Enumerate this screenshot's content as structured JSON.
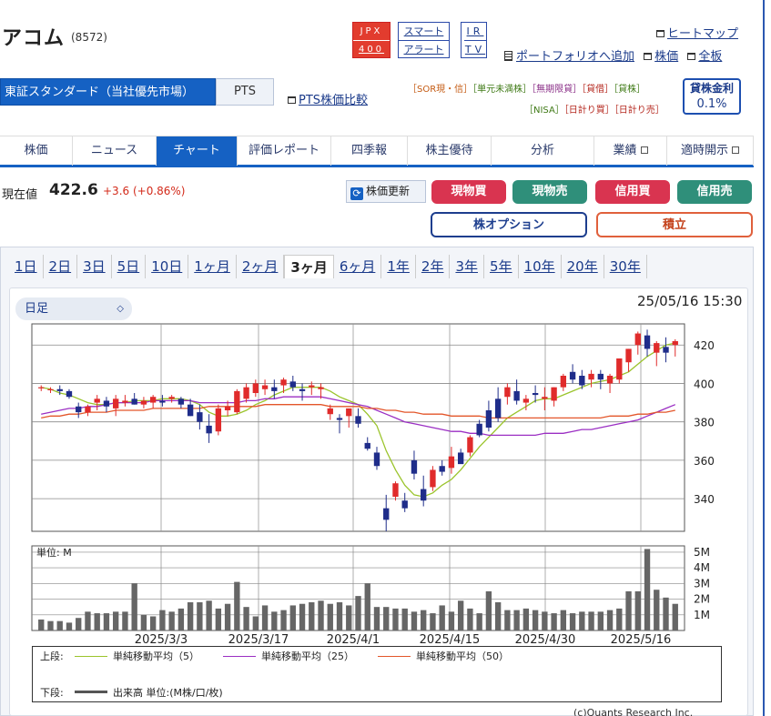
{
  "header": {
    "name": "アコム",
    "code": "(8572)",
    "jpx": [
      "JPX",
      "400"
    ],
    "smart_alert": [
      "スマート",
      "アラート"
    ],
    "ir_tv": [
      "IR",
      "TV"
    ],
    "links": {
      "heatmap": "ヒートマップ",
      "portfolio": "ポートフォリオへ追加",
      "stock": "株価",
      "board": "全板"
    }
  },
  "market": {
    "selected": "東証スタンダード（当社優先市場）",
    "pts": "PTS",
    "pts_compare": "PTS株価比較",
    "tags_row1": [
      {
        "text": "［SOR現・信］",
        "color": "o"
      },
      {
        "text": "［単元未満株］",
        "color": "g"
      },
      {
        "text": "［無期限貸］",
        "color": "p"
      },
      {
        "text": "［貸借］",
        "color": "r"
      },
      {
        "text": "［貸株］",
        "color": "g"
      }
    ],
    "tags_row2": [
      {
        "text": "［NISA］",
        "color": "g"
      },
      {
        "text": "［日計り買］",
        "color": "r"
      },
      {
        "text": "［日計り売］",
        "color": "r"
      }
    ],
    "lend_label": "貸株金利",
    "lend_rate": "0.1%"
  },
  "nav": [
    {
      "label": "株価",
      "width": 80
    },
    {
      "label": "ニュース",
      "width": 92
    },
    {
      "label": "チャート",
      "width": 89,
      "active": true
    },
    {
      "label": "評価レポート",
      "width": 103
    },
    {
      "label": "四季報",
      "width": 84
    },
    {
      "label": "株主優待",
      "width": 92
    },
    {
      "label": "分析",
      "width": 113
    },
    {
      "label": "業績",
      "width": 80,
      "ext": true
    },
    {
      "label": "適時開示",
      "width": 95,
      "ext": true
    }
  ],
  "price": {
    "label": "現在値",
    "value": "422.6",
    "change": "+3.6 (+0.86%)",
    "update": "株価更新"
  },
  "buttons": {
    "spot_buy": "現物買",
    "spot_sell": "現物売",
    "margin_buy": "信用買",
    "margin_sell": "信用売",
    "option": "株オプション",
    "accumulate": "積立"
  },
  "periods": [
    "1日",
    "2日",
    "3日",
    "5日",
    "10日",
    "1ヶ月",
    "2ヶ月",
    "3ヶ月",
    "6ヶ月",
    "1年",
    "2年",
    "3年",
    "5年",
    "10年",
    "20年",
    "30年"
  ],
  "active_period": "3ヶ月",
  "chart_controls": {
    "interval": "日足",
    "timestamp": "25/05/16 15:30"
  },
  "chart_data": {
    "type": "candlestick",
    "y_ticks": [
      420,
      400,
      380,
      360,
      340
    ],
    "ylim": [
      323,
      431
    ],
    "vol_unit_label": "単位: M",
    "vol_ticks": [
      "5M",
      "4M",
      "3M",
      "2M",
      "1M"
    ],
    "vol_ylim": [
      0,
      5.4
    ],
    "x_labels": [
      "2025/3/3",
      "2025/3/17",
      "2025/4/1",
      "2025/4/15",
      "2025/4/30",
      "2025/5/16"
    ],
    "candles": [
      [
        398,
        399,
        396,
        398
      ],
      [
        397,
        398,
        395,
        397
      ],
      [
        397,
        399,
        394,
        396
      ],
      [
        396,
        397,
        392,
        393
      ],
      [
        388,
        390,
        382,
        385
      ],
      [
        385,
        389,
        383,
        388
      ],
      [
        390,
        394,
        386,
        392
      ],
      [
        391,
        393,
        385,
        388
      ],
      [
        387,
        394,
        383,
        392
      ],
      [
        390,
        394,
        388,
        391
      ],
      [
        392,
        395,
        389,
        389
      ],
      [
        389,
        393,
        387,
        391
      ],
      [
        390,
        394,
        387,
        393
      ],
      [
        391,
        394,
        388,
        390
      ],
      [
        392,
        394,
        390,
        393
      ],
      [
        392,
        393,
        387,
        389
      ],
      [
        389,
        392,
        383,
        383
      ],
      [
        385,
        389,
        376,
        380
      ],
      [
        378,
        384,
        369,
        374
      ],
      [
        375,
        389,
        373,
        387
      ],
      [
        386,
        391,
        383,
        388
      ],
      [
        385,
        397,
        384,
        396
      ],
      [
        392,
        400,
        390,
        398
      ],
      [
        395,
        402,
        393,
        400
      ],
      [
        397,
        402,
        394,
        399
      ],
      [
        398,
        402,
        392,
        396
      ],
      [
        399,
        403,
        395,
        402
      ],
      [
        401,
        404,
        396,
        398
      ],
      [
        397,
        400,
        391,
        396
      ],
      [
        398,
        401,
        394,
        399
      ],
      [
        397,
        400,
        392,
        398
      ],
      [
        384,
        389,
        381,
        387
      ],
      [
        382,
        384,
        374,
        381
      ],
      [
        383,
        386,
        377,
        387
      ],
      [
        383,
        387,
        377,
        379
      ],
      [
        369,
        372,
        365,
        366
      ],
      [
        364,
        367,
        355,
        357
      ],
      [
        335,
        342,
        323,
        329
      ],
      [
        341,
        349,
        339,
        348
      ],
      [
        339,
        343,
        333,
        335
      ],
      [
        360,
        365,
        350,
        353
      ],
      [
        345,
        352,
        336,
        339
      ],
      [
        346,
        357,
        344,
        355
      ],
      [
        357,
        360,
        352,
        354
      ],
      [
        356,
        367,
        353,
        362
      ],
      [
        364,
        366,
        359,
        358
      ],
      [
        364,
        373,
        362,
        372
      ],
      [
        379,
        381,
        372,
        373
      ],
      [
        386,
        391,
        375,
        377
      ],
      [
        392,
        398,
        380,
        382
      ],
      [
        393,
        400,
        389,
        398
      ],
      [
        396,
        402,
        389,
        391
      ],
      [
        390,
        394,
        386,
        392
      ],
      [
        395,
        399,
        390,
        394
      ],
      [
        392,
        398,
        386,
        393
      ],
      [
        391,
        398,
        388,
        398
      ],
      [
        398,
        405,
        396,
        404
      ],
      [
        406,
        410,
        400,
        402
      ],
      [
        404,
        407,
        397,
        399
      ],
      [
        402,
        407,
        398,
        405
      ],
      [
        405,
        407,
        397,
        402
      ],
      [
        400,
        405,
        395,
        404
      ],
      [
        402,
        412,
        400,
        413
      ],
      [
        411,
        418,
        406,
        418
      ],
      [
        420,
        427,
        415,
        426
      ],
      [
        425,
        428,
        414,
        418
      ],
      [
        416,
        422,
        409,
        421
      ],
      [
        419,
        424,
        411,
        416
      ],
      [
        420,
        423,
        414,
        422
      ]
    ],
    "volume": [
      0.7,
      0.6,
      0.6,
      0.5,
      0.8,
      1.2,
      1.1,
      1.1,
      1.2,
      1.2,
      3.0,
      1.0,
      0.9,
      1.3,
      1.2,
      1.4,
      1.8,
      1.8,
      1.9,
      1.4,
      1.7,
      3.1,
      1.5,
      0.9,
      1.6,
      1.2,
      1.3,
      1.6,
      1.7,
      1.8,
      1.9,
      1.7,
      1.8,
      1.6,
      2.2,
      3.0,
      1.5,
      1.5,
      1.4,
      1.4,
      1.2,
      1.3,
      1.1,
      1.6,
      1.2,
      1.9,
      1.4,
      1.1,
      2.5,
      1.8,
      1.3,
      1.3,
      1.4,
      1.3,
      1.2,
      1.1,
      1.3,
      1.1,
      1.2,
      1.2,
      1.2,
      1.3,
      1.4,
      2.5,
      2.5,
      5.2,
      2.6,
      2.1,
      1.7
    ],
    "series": [
      {
        "name": "単純移動平均（5）",
        "color": "#9bc42c",
        "values": [
          398,
          397,
          395,
          394,
          392,
          390,
          389,
          389,
          390,
          390,
          391,
          391,
          391,
          392,
          392,
          392,
          391,
          389,
          385,
          383,
          383,
          384,
          386,
          389,
          391,
          394,
          396,
          398,
          398,
          398,
          398,
          396,
          393,
          391,
          389,
          384,
          378,
          365,
          355,
          347,
          342,
          341,
          343,
          347,
          350,
          355,
          361,
          367,
          372,
          377,
          382,
          385,
          388,
          391,
          392,
          392,
          394,
          396,
          398,
          400,
          401,
          402,
          404,
          406,
          410,
          414,
          417,
          420,
          421
        ]
      },
      {
        "name": "単純移動平均（25）",
        "color": "#9b2fc3",
        "values": [
          384,
          385,
          386,
          387,
          387,
          388,
          388,
          389,
          390,
          390,
          390,
          390,
          391,
          391,
          391,
          391,
          391,
          390,
          390,
          390,
          390,
          390,
          391,
          391,
          392,
          392,
          393,
          393,
          393,
          393,
          393,
          392,
          391,
          390,
          389,
          388,
          386,
          384,
          382,
          380,
          379,
          378,
          377,
          376,
          375,
          375,
          374,
          374,
          373,
          373,
          373,
          373,
          373,
          373,
          374,
          374,
          374,
          375,
          376,
          376,
          377,
          378,
          379,
          380,
          381,
          383,
          385,
          387,
          389
        ]
      },
      {
        "name": "単純移動平均（50）",
        "color": "#e3562a",
        "values": [
          382,
          383,
          383,
          384,
          384,
          385,
          385,
          385,
          386,
          386,
          386,
          386,
          387,
          387,
          387,
          387,
          387,
          387,
          388,
          388,
          388,
          388,
          388,
          388,
          389,
          389,
          389,
          389,
          389,
          389,
          389,
          388,
          388,
          388,
          388,
          387,
          387,
          386,
          386,
          385,
          385,
          384,
          384,
          384,
          383,
          383,
          383,
          383,
          382,
          382,
          382,
          382,
          382,
          382,
          382,
          382,
          382,
          382,
          382,
          382,
          382,
          383,
          383,
          383,
          384,
          384,
          385,
          385,
          386
        ]
      }
    ],
    "legend": {
      "upper": "上段:",
      "lower": "下段:",
      "volume_label": "出来高 単位:(M株/口/枚)"
    }
  },
  "copyright": "(c)Quants Research Inc."
}
